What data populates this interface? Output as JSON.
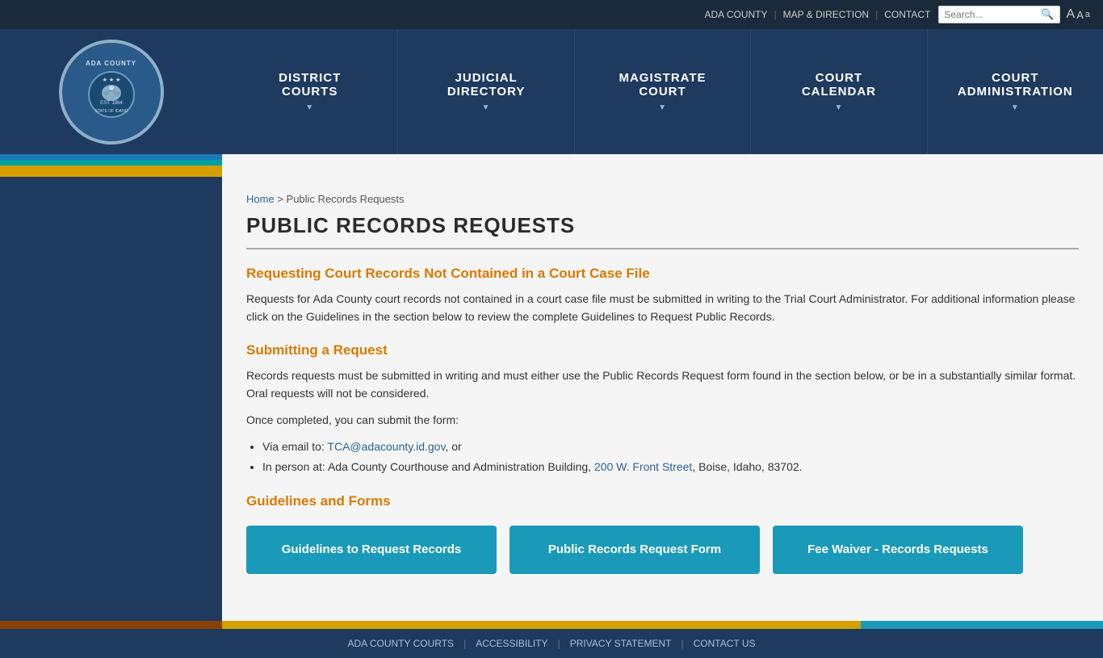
{
  "topbar": {
    "ada_county": "ADA COUNTY",
    "map_direction": "MAP & DIRECTION",
    "contact": "CONTACT",
    "search_placeholder": "Search...",
    "font_a_large": "A",
    "font_a_medium": "A",
    "font_a_small": "a"
  },
  "nav": {
    "items": [
      {
        "id": "district-courts",
        "line1": "DISTRICT",
        "line2": "COURTS"
      },
      {
        "id": "judicial-directory",
        "line1": "JUDICIAL",
        "line2": "DIRECTORY"
      },
      {
        "id": "magistrate-court",
        "line1": "MAGISTRATE",
        "line2": "COURT"
      },
      {
        "id": "court-calendar",
        "line1": "COURT",
        "line2": "CALENDAR"
      },
      {
        "id": "court-administration",
        "line1": "COURT",
        "line2": "ADMINISTRATION"
      }
    ]
  },
  "breadcrumb": {
    "home": "Home",
    "current": "Public Records Requests"
  },
  "page": {
    "title": "PUBLIC RECORDS REQUESTS",
    "section1_heading": "Requesting Court Records Not Contained in a Court Case File",
    "section1_body": "Requests for Ada County court records not contained in a court case file must be submitted in writing to the Trial Court Administrator.  For additional information please click on the Guidelines in the section below to review the complete Guidelines to Request Public Records.",
    "section2_heading": "Submitting a Request",
    "section2_body1": "Records requests must be submitted in writing and must either use the Public Records Request form found in the section below, or be in a substantially similar format. Oral requests will not be considered.",
    "section2_body2": "Once completed, you can submit the form:",
    "list_item1_prefix": "Via email to: ",
    "list_item1_email": "TCA@adacounty.id.gov",
    "list_item1_suffix": ", or",
    "list_item2": "In person at:  Ada County Courthouse and Administration Building, 200 W. Front Street, Boise, Idaho, 83702.",
    "list_item2_address": "200 W. Front Street",
    "section3_heading": "Guidelines and Forms",
    "btn1": "Guidelines to Request Records",
    "btn2": "Public Records Request Form",
    "btn3": "Fee Waiver - Records Requests"
  },
  "footer": {
    "link1": "ADA COUNTY COURTS",
    "link2": "ACCESSIBILITY",
    "link3": "PRIVACY STATEMENT",
    "link4": "CONTACT US"
  },
  "seal": {
    "top_text": "ADA COUNTY",
    "bottom_text": "STATE OF IDAHO",
    "year": "EST. 1864"
  }
}
